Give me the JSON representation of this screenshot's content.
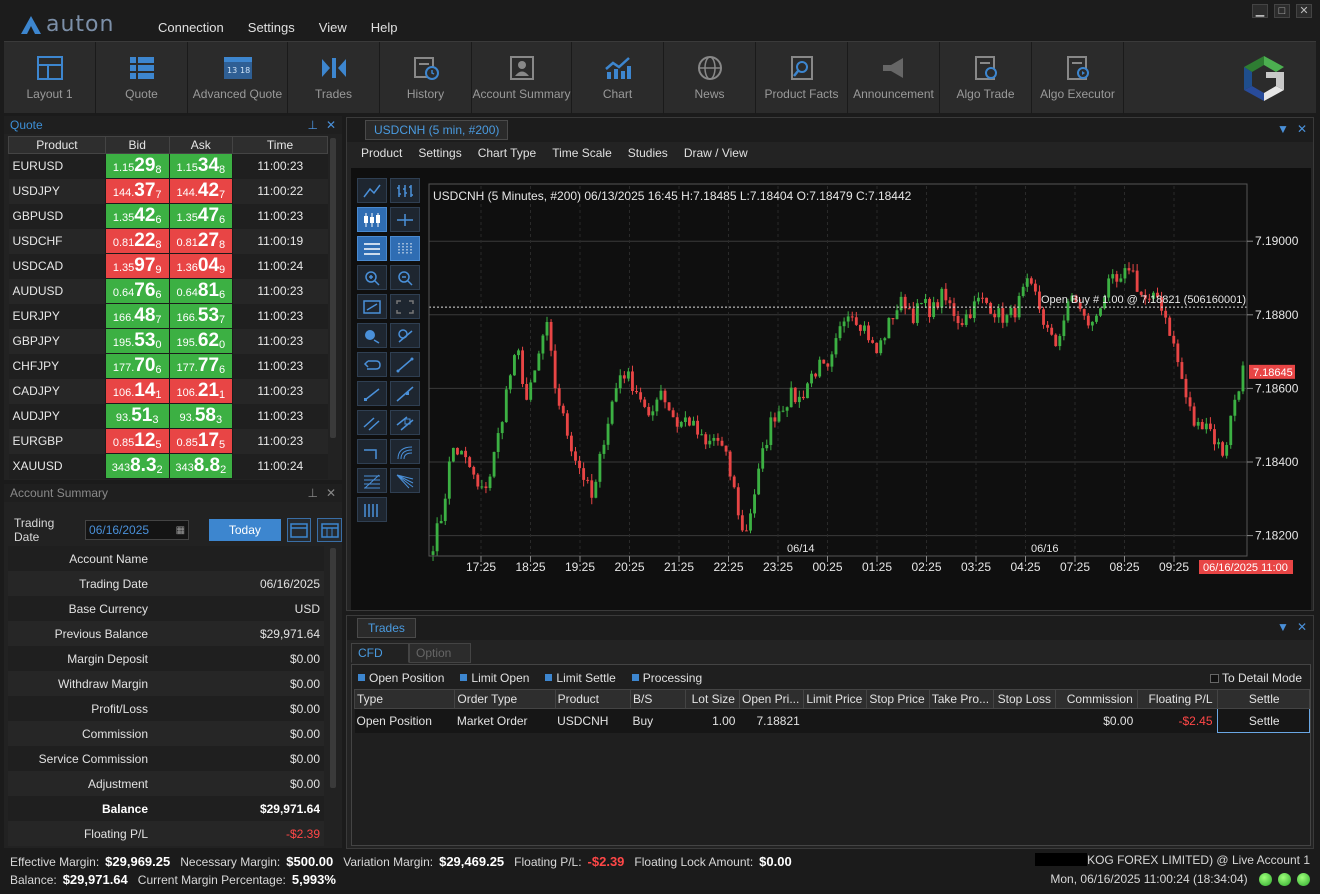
{
  "app": {
    "logo_text": "auton"
  },
  "menu": [
    "Connection",
    "Settings",
    "View",
    "Help"
  ],
  "window_controls": [
    "▁",
    "□",
    "✕"
  ],
  "toolbar": [
    {
      "label": "Layout 1",
      "icon": "layout-icon"
    },
    {
      "label": "Quote",
      "icon": "quote-list-icon"
    },
    {
      "label": "Advanced Quote",
      "icon": "advanced-quote-icon"
    },
    {
      "label": "Trades",
      "icon": "trades-icon"
    },
    {
      "label": "History",
      "icon": "history-icon"
    },
    {
      "label": "Account Summary",
      "icon": "account-summary-icon"
    },
    {
      "label": "Chart",
      "icon": "chart-icon"
    },
    {
      "label": "News",
      "icon": "news-icon"
    },
    {
      "label": "Product Facts",
      "icon": "product-facts-icon"
    },
    {
      "label": "Announcement",
      "icon": "announcement-icon"
    },
    {
      "label": "Algo Trade",
      "icon": "algo-trade-icon"
    },
    {
      "label": "Algo Executor",
      "icon": "algo-executor-icon"
    }
  ],
  "quote": {
    "title": "Quote",
    "headers": [
      "Product",
      "Bid",
      "Ask",
      "Time"
    ],
    "rows": [
      {
        "product": "EURUSD",
        "bid": [
          "1.15",
          "29",
          "8"
        ],
        "ask": [
          "1.15",
          "34",
          "8"
        ],
        "time": "11:00:23",
        "dir": "up"
      },
      {
        "product": "USDJPY",
        "bid": [
          "144.",
          "37",
          "7"
        ],
        "ask": [
          "144.",
          "42",
          "7"
        ],
        "time": "11:00:22",
        "dir": "dn"
      },
      {
        "product": "GBPUSD",
        "bid": [
          "1.35",
          "42",
          "6"
        ],
        "ask": [
          "1.35",
          "47",
          "6"
        ],
        "time": "11:00:23",
        "dir": "up"
      },
      {
        "product": "USDCHF",
        "bid": [
          "0.81",
          "22",
          "8"
        ],
        "ask": [
          "0.81",
          "27",
          "8"
        ],
        "time": "11:00:19",
        "dir": "dn"
      },
      {
        "product": "USDCAD",
        "bid": [
          "1.35",
          "97",
          "9"
        ],
        "ask": [
          "1.36",
          "04",
          "9"
        ],
        "time": "11:00:24",
        "dir": "dn"
      },
      {
        "product": "AUDUSD",
        "bid": [
          "0.64",
          "76",
          "6"
        ],
        "ask": [
          "0.64",
          "81",
          "6"
        ],
        "time": "11:00:23",
        "dir": "up"
      },
      {
        "product": "EURJPY",
        "bid": [
          "166.",
          "48",
          "7"
        ],
        "ask": [
          "166.",
          "53",
          "7"
        ],
        "time": "11:00:23",
        "dir": "up"
      },
      {
        "product": "GBPJPY",
        "bid": [
          "195.",
          "53",
          "0"
        ],
        "ask": [
          "195.",
          "62",
          "0"
        ],
        "time": "11:00:23",
        "dir": "up"
      },
      {
        "product": "CHFJPY",
        "bid": [
          "177.",
          "70",
          "6"
        ],
        "ask": [
          "177.",
          "77",
          "6"
        ],
        "time": "11:00:23",
        "dir": "up"
      },
      {
        "product": "CADJPY",
        "bid": [
          "106.",
          "14",
          "1"
        ],
        "ask": [
          "106.",
          "21",
          "1"
        ],
        "time": "11:00:23",
        "dir": "dn"
      },
      {
        "product": "AUDJPY",
        "bid": [
          "93.",
          "51",
          "3"
        ],
        "ask": [
          "93.",
          "58",
          "3"
        ],
        "time": "11:00:23",
        "dir": "up"
      },
      {
        "product": "EURGBP",
        "bid": [
          "0.85",
          "12",
          "5"
        ],
        "ask": [
          "0.85",
          "17",
          "5"
        ],
        "time": "11:00:23",
        "dir": "dn"
      },
      {
        "product": "XAUUSD",
        "bid": [
          "343",
          "8.3",
          "2"
        ],
        "ask": [
          "343",
          "8.8",
          "2"
        ],
        "time": "11:00:24",
        "dir": "up"
      }
    ]
  },
  "account": {
    "title": "Account Summary",
    "trading_date_label": "Trading Date",
    "trading_date_value": "06/16/2025",
    "today_label": "Today",
    "rows": [
      {
        "label": "Account Name",
        "value": ""
      },
      {
        "label": "Trading Date",
        "value": "06/16/2025"
      },
      {
        "label": "Base Currency",
        "value": "USD"
      },
      {
        "label": "Previous Balance",
        "value": "$29,971.64"
      },
      {
        "label": "Margin Deposit",
        "value": "$0.00"
      },
      {
        "label": "Withdraw Margin",
        "value": "$0.00"
      },
      {
        "label": "Profit/Loss",
        "value": "$0.00"
      },
      {
        "label": "Commission",
        "value": "$0.00"
      },
      {
        "label": "Service Commission",
        "value": "$0.00"
      },
      {
        "label": "Adjustment",
        "value": "$0.00"
      },
      {
        "label": "Balance",
        "value": "$29,971.64",
        "bold": true
      },
      {
        "label": "Floating P/L",
        "value": "-$2.39",
        "neg": true
      }
    ]
  },
  "chart": {
    "tab": "USDCNH (5 min, #200)",
    "menu": [
      "Product",
      "Settings",
      "Chart Type",
      "Time Scale",
      "Studies",
      "Draw / View"
    ],
    "header": "USDCNH (5 Minutes, #200)  06/13/2025 16:45 H:7.18485 L:7.18404 O:7.18479 C:7.18442",
    "open_buy_label": "Open Buy # 1.00 @ 7.18821 (506160001)",
    "current_price_label": "7.18645",
    "time_label": "06/16/2025 11:00",
    "date_markers": [
      "06/14",
      "06/16"
    ]
  },
  "chart_data": {
    "type": "candlestick",
    "ylim": [
      7.1815,
      7.1915
    ],
    "yticks": [
      "7.19000",
      "7.18800",
      "7.18600",
      "7.18400",
      "7.18200"
    ],
    "xticks": [
      "17:25",
      "18:25",
      "19:25",
      "20:25",
      "21:25",
      "22:25",
      "23:25",
      "00:25",
      "01:25",
      "02:25",
      "03:25",
      "04:25",
      "07:25",
      "08:25",
      "09:25"
    ],
    "open_buy_price": 7.18821,
    "current_price": 7.18645,
    "close_path": [
      7.1818,
      7.1826,
      7.1844,
      7.1842,
      7.1838,
      7.1831,
      7.1836,
      7.1848,
      7.1862,
      7.187,
      7.1856,
      7.1866,
      7.1878,
      7.186,
      7.185,
      7.1842,
      7.1836,
      7.1829,
      7.1845,
      7.1856,
      7.1865,
      7.1862,
      7.1858,
      7.185,
      7.1861,
      7.1855,
      7.185,
      7.1852,
      7.1848,
      7.1844,
      7.1847,
      7.1842,
      7.1832,
      7.1819,
      7.183,
      7.1842,
      7.1852,
      7.1855,
      7.1858,
      7.1857,
      7.1863,
      7.1866,
      7.1864,
      7.1874,
      7.1882,
      7.1879,
      7.1876,
      7.1869,
      7.1875,
      7.1881,
      7.1884,
      7.188,
      7.1883,
      7.1881,
      7.1885,
      7.1882,
      7.1878,
      7.1881,
      7.1884,
      7.1883,
      7.188,
      7.1879,
      7.1882,
      7.1888,
      7.1885,
      7.1877,
      7.1871,
      7.1879,
      7.1886,
      7.1879,
      7.1877,
      7.1884,
      7.1889,
      7.1888,
      7.1894,
      7.1886,
      7.1883,
      7.1885,
      7.1878,
      7.1868,
      7.1857,
      7.1849,
      7.1852,
      7.1846,
      7.1842,
      7.1856,
      7.1865
    ]
  },
  "trades": {
    "tab": "Trades",
    "subtabs": [
      "CFD",
      "Option"
    ],
    "filters": [
      "Open Position",
      "Limit Open",
      "Limit Settle",
      "Processing"
    ],
    "detail_mode": "To Detail Mode",
    "headers": [
      "Type",
      "Order Type",
      "Product",
      "B/S",
      "Lot Size",
      "Open Pri...",
      "Limit Price",
      "Stop Price",
      "Take Pro...",
      "Stop Loss",
      "Commission",
      "Floating P/L",
      "Settle"
    ],
    "rows": [
      {
        "type": "Open Position",
        "order_type": "Market Order",
        "product": "USDCNH",
        "bs": "Buy",
        "lot": "1.00",
        "open": "7.18821",
        "limit": "",
        "stop": "",
        "tp": "",
        "sl": "",
        "commission": "$0.00",
        "pl": "-$2.45",
        "settle": "Settle"
      }
    ]
  },
  "status": {
    "effective_margin_label": "Effective Margin:",
    "effective_margin": "$29,969.25",
    "necessary_margin_label": "Necessary Margin:",
    "necessary_margin": "$500.00",
    "variation_margin_label": "Variation Margin:",
    "variation_margin": "$29,469.25",
    "floating_pl_label": "Floating P/L:",
    "floating_pl": "-$2.39",
    "floating_lock_label": "Floating Lock Amount:",
    "floating_lock": "$0.00",
    "balance_label": "Balance:",
    "balance": "$29,971.64",
    "current_margin_label": "Current Margin Percentage:",
    "current_margin": "5,993%",
    "account_info": "KOG FOREX LIMITED) @ Live Account 1",
    "datetime": "Mon, 06/16/2025 11:00:24 (18:34:04)"
  },
  "colors": {
    "accent": "#3d86cf",
    "up": "#3cb043",
    "down": "#e84545"
  }
}
